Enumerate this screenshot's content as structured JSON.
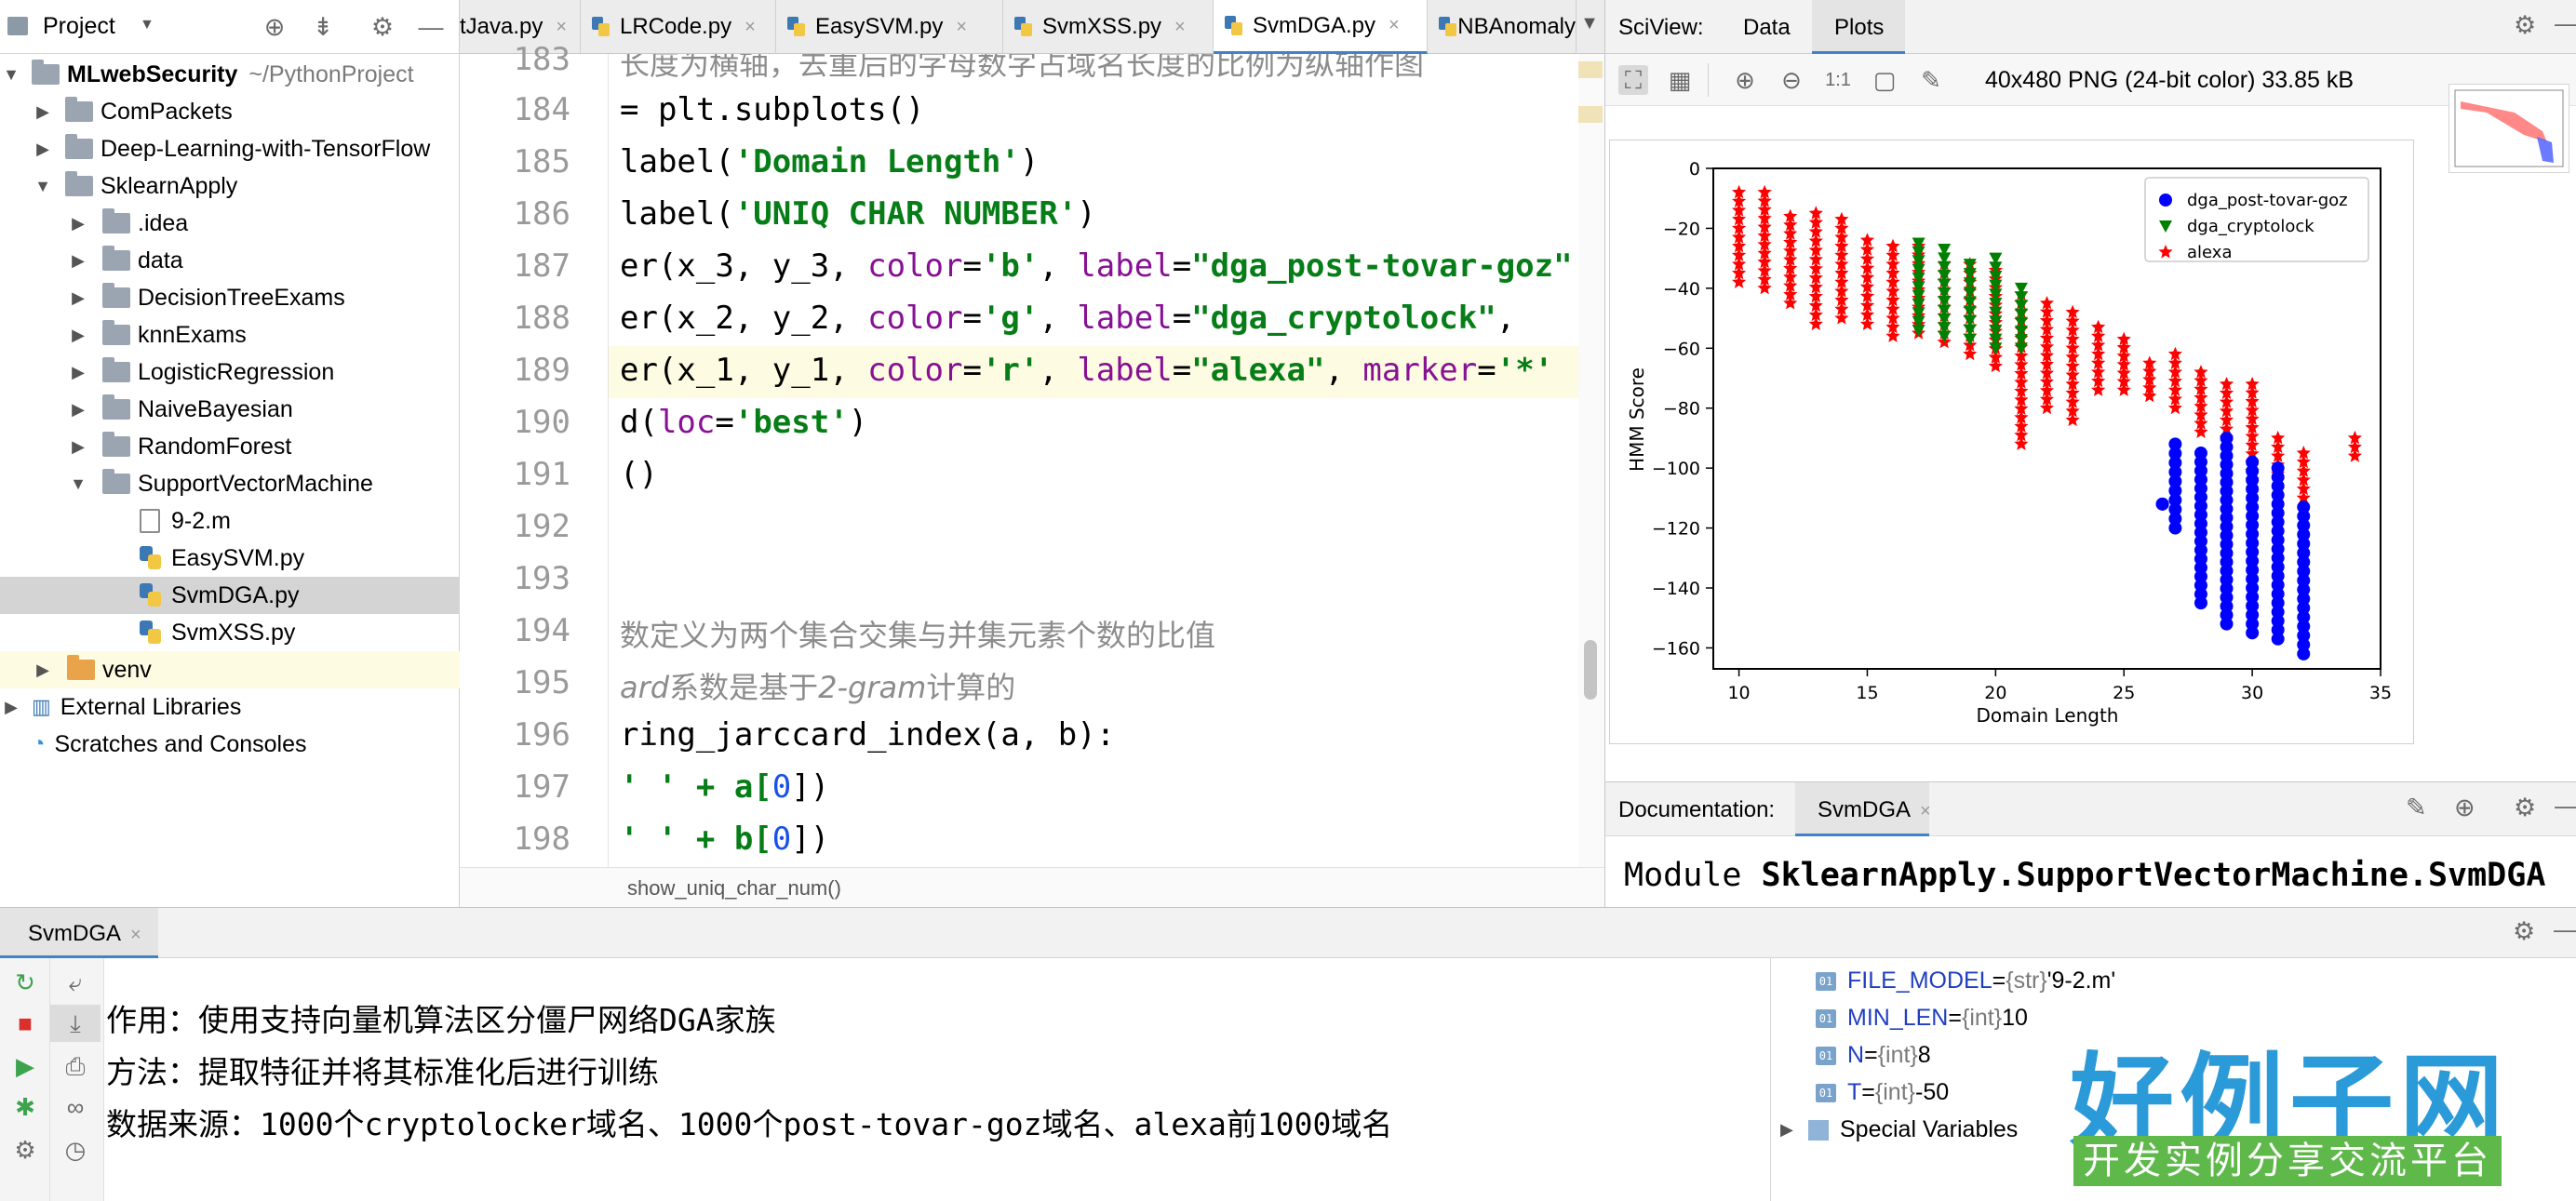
{
  "project": {
    "title": "Project",
    "tree": [
      {
        "label": "MLwebSecurity",
        "hint": "~/PythonProject"
      },
      {
        "label": "ComPackets"
      },
      {
        "label": "Deep-Learning-with-TensorFlow"
      },
      {
        "label": "SklearnApply"
      },
      {
        "label": ".idea"
      },
      {
        "label": "data"
      },
      {
        "label": "DecisionTreeExams"
      },
      {
        "label": "knnExams"
      },
      {
        "label": "LogisticRegression"
      },
      {
        "label": "NaiveBayesian"
      },
      {
        "label": "RandomForest"
      },
      {
        "label": "SupportVectorMachine"
      },
      {
        "label": "9-2.m"
      },
      {
        "label": "EasySVM.py"
      },
      {
        "label": "SvmDGA.py"
      },
      {
        "label": "SvmXSS.py"
      },
      {
        "label": "venv"
      },
      {
        "label": "External Libraries"
      },
      {
        "label": "Scratches and Consoles"
      }
    ]
  },
  "editor": {
    "tabs": [
      "tJava.py",
      "LRCode.py",
      "EasySVM.py",
      "SvmXSS.py",
      "SvmDGA.py",
      "NBAnomaly"
    ],
    "active_tab": "SvmDGA.py",
    "line_numbers": [
      "183",
      "184",
      "185",
      "186",
      "187",
      "188",
      "189",
      "190",
      "191",
      "192",
      "193",
      "194",
      "195",
      "196",
      "197",
      "198"
    ],
    "lines": {
      "l183": "长度为横轴，去重后的字母数字占域名长度的比例为纵轴作图",
      "l184": "= plt.subplots()",
      "l185a": "label(",
      "l185b": "'Domain Length'",
      "l185c": ")",
      "l186a": "label(",
      "l186b": "'UNIQ CHAR NUMBER'",
      "l186c": ")",
      "l187a": "er(x_3, y_3, ",
      "l187b": "color",
      "l187c": "=",
      "l187d": "'b'",
      "l187e": ", ",
      "l187f": "label",
      "l187g": "=",
      "l187h": "\"dga_post-tovar-goz\"",
      "l188a": "er(x_2, y_2, ",
      "l188b": "color",
      "l188c": "=",
      "l188d": "'g'",
      "l188e": ", ",
      "l188f": "label",
      "l188g": "=",
      "l188h": "\"dga_cryptolock\"",
      "l188i": ",",
      "l189a": "er(x_1, y_1, ",
      "l189b": "color",
      "l189c": "=",
      "l189d": "'r'",
      "l189e": ", ",
      "l189f": "label",
      "l189g": "=",
      "l189h": "\"alexa\"",
      "l189i": ", ",
      "l189j": "marker",
      "l189k": "=",
      "l189l": "'*'",
      "l190a": "d(",
      "l190b": "loc",
      "l190c": "=",
      "l190d": "'best'",
      "l190e": ")",
      "l191": "()",
      "l194": "数定义为两个集合交集与并集元素个数的比值",
      "l195a": "ard",
      "l195b": "系数是基于",
      "l195c": "2-gram",
      "l195d": "计算的",
      "l196": "ring_jarccard_index(a, b):",
      "l197a": "' ' + a[",
      "l197b": "0",
      "l197c": "])",
      "l198a": "' ' + b[",
      "l198b": "0",
      "l198c": "])"
    },
    "breadcrumb": "show_uniq_char_num()"
  },
  "sciview": {
    "label": "SciView:",
    "tabs": [
      "Data",
      "Plots"
    ],
    "active_tab": "Plots",
    "image_info": "40x480 PNG (24-bit color) 33.85 kB"
  },
  "chart_data": {
    "type": "scatter",
    "title": "",
    "xlabel": "Domain Length",
    "ylabel": "HMM Score",
    "xlim": [
      9,
      35
    ],
    "ylim": [
      -167,
      0
    ],
    "xticks": [
      "10",
      "15",
      "20",
      "25",
      "30",
      "35"
    ],
    "yticks": [
      "0",
      "−20",
      "−40",
      "−60",
      "−80",
      "−100",
      "−120",
      "−140",
      "−160"
    ],
    "legend_position": "top-right",
    "series": [
      {
        "name": "dga_post-tovar-goz",
        "color": "#0000ff",
        "marker": "circle",
        "columns": [
          {
            "x": 26.5,
            "ymin": -112,
            "ymax": -112
          },
          {
            "x": 27,
            "ymin": -120,
            "ymax": -92
          },
          {
            "x": 28,
            "ymin": -145,
            "ymax": -95
          },
          {
            "x": 29,
            "ymin": -152,
            "ymax": -90
          },
          {
            "x": 30,
            "ymin": -155,
            "ymax": -98
          },
          {
            "x": 31,
            "ymin": -157,
            "ymax": -100
          },
          {
            "x": 32,
            "ymin": -162,
            "ymax": -113
          }
        ]
      },
      {
        "name": "dga_cryptolock",
        "color": "#008000",
        "marker": "triangle",
        "columns": [
          {
            "x": 17,
            "ymin": -54,
            "ymax": -25
          },
          {
            "x": 18,
            "ymin": -56,
            "ymax": -27
          },
          {
            "x": 19,
            "ymin": -57,
            "ymax": -32
          },
          {
            "x": 20,
            "ymin": -60,
            "ymax": -30
          },
          {
            "x": 21,
            "ymin": -60,
            "ymax": -40
          }
        ]
      },
      {
        "name": "alexa",
        "color": "#ff0000",
        "marker": "star",
        "columns": [
          {
            "x": 10,
            "ymin": -38,
            "ymax": -8
          },
          {
            "x": 11,
            "ymin": -40,
            "ymax": -8
          },
          {
            "x": 12,
            "ymin": -45,
            "ymax": -16
          },
          {
            "x": 13,
            "ymin": -52,
            "ymax": -15
          },
          {
            "x": 14,
            "ymin": -50,
            "ymax": -17
          },
          {
            "x": 15,
            "ymin": -52,
            "ymax": -24
          },
          {
            "x": 16,
            "ymin": -56,
            "ymax": -26
          },
          {
            "x": 17,
            "ymin": -55,
            "ymax": -26
          },
          {
            "x": 18,
            "ymin": -58,
            "ymax": -32
          },
          {
            "x": 19,
            "ymin": -62,
            "ymax": -32
          },
          {
            "x": 20,
            "ymin": -66,
            "ymax": -34
          },
          {
            "x": 21,
            "ymin": -92,
            "ymax": -42
          },
          {
            "x": 22,
            "ymin": -80,
            "ymax": -45
          },
          {
            "x": 23,
            "ymin": -84,
            "ymax": -48
          },
          {
            "x": 24,
            "ymin": -74,
            "ymax": -53
          },
          {
            "x": 25,
            "ymin": -74,
            "ymax": -57
          },
          {
            "x": 26,
            "ymin": -76,
            "ymax": -65
          },
          {
            "x": 27,
            "ymin": -80,
            "ymax": -62
          },
          {
            "x": 28,
            "ymin": -88,
            "ymax": -68
          },
          {
            "x": 29,
            "ymin": -90,
            "ymax": -72
          },
          {
            "x": 30,
            "ymin": -104,
            "ymax": -72
          },
          {
            "x": 31,
            "ymin": -102,
            "ymax": -90
          },
          {
            "x": 32,
            "ymin": -110,
            "ymax": -95
          },
          {
            "x": 34,
            "ymin": -96,
            "ymax": -90
          }
        ]
      }
    ]
  },
  "documentation": {
    "label": "Documentation:",
    "tab": "SvmDGA",
    "text_prefix": "Module ",
    "text_module": "SklearnApply.SupportVectorMachine.SvmDGA"
  },
  "run": {
    "tab": "SvmDGA",
    "console": [
      "作用：使用支持向量机算法区分僵尸网络DGA家族",
      "方法：提取特征并将其标准化后进行训练",
      "数据来源：1000个cryptolocker域名、1000个post-tovar-goz域名、alexa前1000域名"
    ],
    "variables": [
      {
        "name": "FILE_MODEL",
        "eq": " = ",
        "type": "{str}",
        "value": " '9-2.m'"
      },
      {
        "name": "MIN_LEN",
        "eq": " = ",
        "type": "{int}",
        "value": " 10"
      },
      {
        "name": "N",
        "eq": " = ",
        "type": "{int}",
        "value": " 8"
      },
      {
        "name": "T",
        "eq": " = ",
        "type": "{int}",
        "value": " -50"
      }
    ],
    "special": "Special Variables"
  },
  "watermark": {
    "logo_text": "好例子网",
    "logo_sub": "开发实例分享交流平台"
  },
  "colors": {
    "accent": "#4083c9",
    "string_green": "#067d17",
    "keyword_purple": "#871094",
    "number_blue": "#1750eb"
  }
}
